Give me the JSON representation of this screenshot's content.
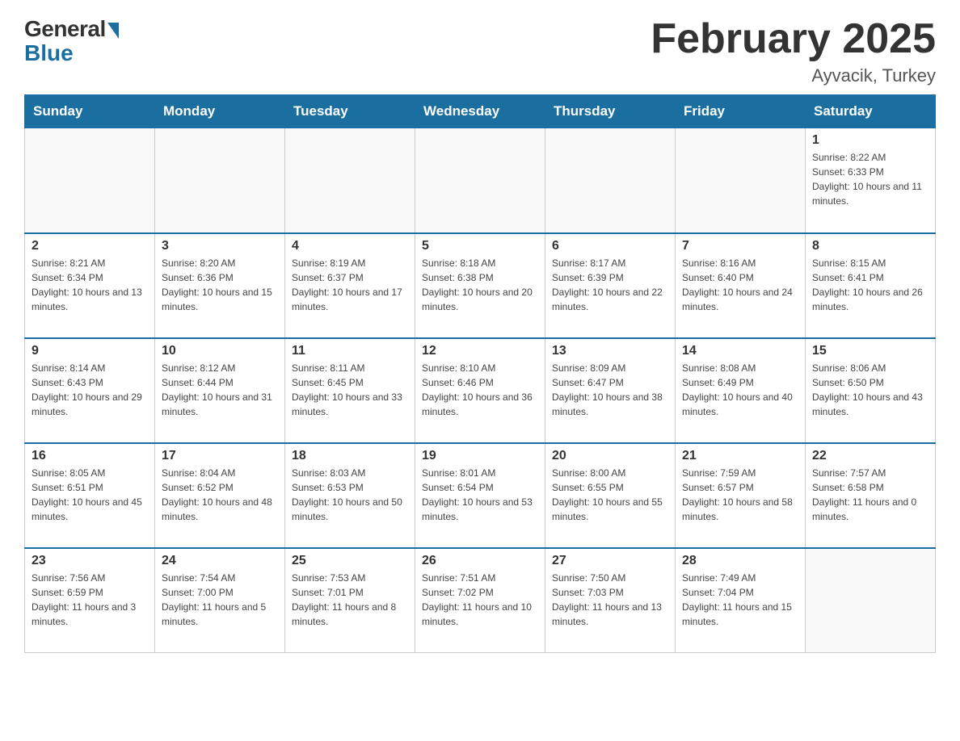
{
  "header": {
    "logo_general": "General",
    "logo_blue": "Blue",
    "month_title": "February 2025",
    "location": "Ayvacik, Turkey"
  },
  "days_of_week": [
    "Sunday",
    "Monday",
    "Tuesday",
    "Wednesday",
    "Thursday",
    "Friday",
    "Saturday"
  ],
  "weeks": [
    [
      {
        "day": "",
        "info": ""
      },
      {
        "day": "",
        "info": ""
      },
      {
        "day": "",
        "info": ""
      },
      {
        "day": "",
        "info": ""
      },
      {
        "day": "",
        "info": ""
      },
      {
        "day": "",
        "info": ""
      },
      {
        "day": "1",
        "info": "Sunrise: 8:22 AM\nSunset: 6:33 PM\nDaylight: 10 hours and 11 minutes."
      }
    ],
    [
      {
        "day": "2",
        "info": "Sunrise: 8:21 AM\nSunset: 6:34 PM\nDaylight: 10 hours and 13 minutes."
      },
      {
        "day": "3",
        "info": "Sunrise: 8:20 AM\nSunset: 6:36 PM\nDaylight: 10 hours and 15 minutes."
      },
      {
        "day": "4",
        "info": "Sunrise: 8:19 AM\nSunset: 6:37 PM\nDaylight: 10 hours and 17 minutes."
      },
      {
        "day": "5",
        "info": "Sunrise: 8:18 AM\nSunset: 6:38 PM\nDaylight: 10 hours and 20 minutes."
      },
      {
        "day": "6",
        "info": "Sunrise: 8:17 AM\nSunset: 6:39 PM\nDaylight: 10 hours and 22 minutes."
      },
      {
        "day": "7",
        "info": "Sunrise: 8:16 AM\nSunset: 6:40 PM\nDaylight: 10 hours and 24 minutes."
      },
      {
        "day": "8",
        "info": "Sunrise: 8:15 AM\nSunset: 6:41 PM\nDaylight: 10 hours and 26 minutes."
      }
    ],
    [
      {
        "day": "9",
        "info": "Sunrise: 8:14 AM\nSunset: 6:43 PM\nDaylight: 10 hours and 29 minutes."
      },
      {
        "day": "10",
        "info": "Sunrise: 8:12 AM\nSunset: 6:44 PM\nDaylight: 10 hours and 31 minutes."
      },
      {
        "day": "11",
        "info": "Sunrise: 8:11 AM\nSunset: 6:45 PM\nDaylight: 10 hours and 33 minutes."
      },
      {
        "day": "12",
        "info": "Sunrise: 8:10 AM\nSunset: 6:46 PM\nDaylight: 10 hours and 36 minutes."
      },
      {
        "day": "13",
        "info": "Sunrise: 8:09 AM\nSunset: 6:47 PM\nDaylight: 10 hours and 38 minutes."
      },
      {
        "day": "14",
        "info": "Sunrise: 8:08 AM\nSunset: 6:49 PM\nDaylight: 10 hours and 40 minutes."
      },
      {
        "day": "15",
        "info": "Sunrise: 8:06 AM\nSunset: 6:50 PM\nDaylight: 10 hours and 43 minutes."
      }
    ],
    [
      {
        "day": "16",
        "info": "Sunrise: 8:05 AM\nSunset: 6:51 PM\nDaylight: 10 hours and 45 minutes."
      },
      {
        "day": "17",
        "info": "Sunrise: 8:04 AM\nSunset: 6:52 PM\nDaylight: 10 hours and 48 minutes."
      },
      {
        "day": "18",
        "info": "Sunrise: 8:03 AM\nSunset: 6:53 PM\nDaylight: 10 hours and 50 minutes."
      },
      {
        "day": "19",
        "info": "Sunrise: 8:01 AM\nSunset: 6:54 PM\nDaylight: 10 hours and 53 minutes."
      },
      {
        "day": "20",
        "info": "Sunrise: 8:00 AM\nSunset: 6:55 PM\nDaylight: 10 hours and 55 minutes."
      },
      {
        "day": "21",
        "info": "Sunrise: 7:59 AM\nSunset: 6:57 PM\nDaylight: 10 hours and 58 minutes."
      },
      {
        "day": "22",
        "info": "Sunrise: 7:57 AM\nSunset: 6:58 PM\nDaylight: 11 hours and 0 minutes."
      }
    ],
    [
      {
        "day": "23",
        "info": "Sunrise: 7:56 AM\nSunset: 6:59 PM\nDaylight: 11 hours and 3 minutes."
      },
      {
        "day": "24",
        "info": "Sunrise: 7:54 AM\nSunset: 7:00 PM\nDaylight: 11 hours and 5 minutes."
      },
      {
        "day": "25",
        "info": "Sunrise: 7:53 AM\nSunset: 7:01 PM\nDaylight: 11 hours and 8 minutes."
      },
      {
        "day": "26",
        "info": "Sunrise: 7:51 AM\nSunset: 7:02 PM\nDaylight: 11 hours and 10 minutes."
      },
      {
        "day": "27",
        "info": "Sunrise: 7:50 AM\nSunset: 7:03 PM\nDaylight: 11 hours and 13 minutes."
      },
      {
        "day": "28",
        "info": "Sunrise: 7:49 AM\nSunset: 7:04 PM\nDaylight: 11 hours and 15 minutes."
      },
      {
        "day": "",
        "info": ""
      }
    ]
  ]
}
